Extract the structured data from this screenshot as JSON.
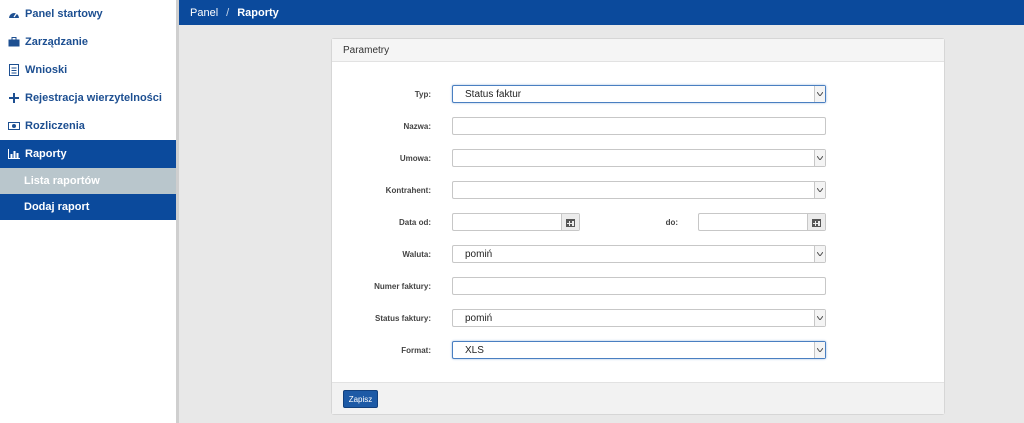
{
  "sidebar": {
    "items": [
      {
        "label": "Panel startowy",
        "icon": "dashboard-icon"
      },
      {
        "label": "Zarządzanie",
        "icon": "briefcase-icon"
      },
      {
        "label": "Wnioski",
        "icon": "document-icon"
      },
      {
        "label": "Rejestracja wierzytelności",
        "icon": "plus-icon"
      },
      {
        "label": "Rozliczenia",
        "icon": "money-icon"
      },
      {
        "label": "Raporty",
        "icon": "bar-chart-icon"
      }
    ],
    "subitems": [
      {
        "label": "Lista raportów"
      },
      {
        "label": "Dodaj raport"
      }
    ]
  },
  "breadcrumb": {
    "root": "Panel",
    "separator": "/",
    "current": "Raporty"
  },
  "panel": {
    "title": "Parametry",
    "save_label": "Zapisz",
    "fields": {
      "typ": {
        "label": "Typ:",
        "value": "Status faktur"
      },
      "nazwa": {
        "label": "Nazwa:",
        "value": ""
      },
      "umowa": {
        "label": "Umowa:",
        "value": ""
      },
      "kontrahent": {
        "label": "Kontrahent:",
        "value": ""
      },
      "data_od": {
        "label": "Data od:",
        "value": ""
      },
      "data_do": {
        "label": "do:",
        "value": ""
      },
      "waluta": {
        "label": "Waluta:",
        "value": "pomiń"
      },
      "numer_faktury": {
        "label": "Numer faktury:",
        "value": ""
      },
      "status_faktury": {
        "label": "Status faktury:",
        "value": "pomiń"
      },
      "format": {
        "label": "Format:",
        "value": "XLS"
      }
    }
  },
  "colors": {
    "brand": "#0b4a9c",
    "selected_sub": "#b9c6cc"
  }
}
